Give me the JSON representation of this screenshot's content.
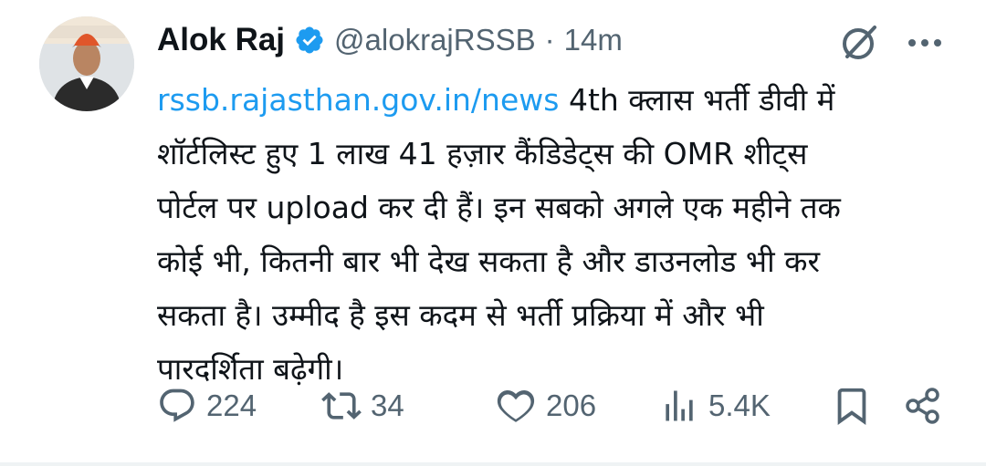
{
  "tweet": {
    "author_name": "Alok Raj",
    "handle": "@alokrajRSSB",
    "separator": "·",
    "time": "14m",
    "link_text": "rssb.rajasthan.gov.in/news",
    "text_line1": "4th क्लास भर्ती डीवी में",
    "text_line2": "शॉर्टलिस्ट हुए 1 लाख 41 हज़ार कैंडिडेट्स की OMR शीट्स",
    "text_line3": "पोर्टल पर upload कर दी हैं। इन सबको अगले एक महीने तक",
    "text_line4": "कोई भी, कितनी बार भी देख सकता है और डाउनलोड भी कर",
    "text_line5": "सकता है। उम्मीद है इस कदम से भर्ती प्रक्रिया में और भी",
    "text_line6": "पारदर्शिता बढ़ेगी।"
  },
  "stats": {
    "replies": "224",
    "reposts": "34",
    "likes": "206",
    "views": "5.4K"
  },
  "colors": {
    "link": "#1d9bf0",
    "verified_badge": "#1d9bf0",
    "secondary_text": "#536471",
    "primary_text": "#0f1419"
  },
  "icons": {
    "verified": "verified-badge-icon",
    "grok": "grok-icon",
    "more": "more-options-icon",
    "reply": "reply-icon",
    "repost": "repost-icon",
    "like": "heart-icon",
    "views": "views-chart-icon",
    "bookmark": "bookmark-icon",
    "share": "share-icon"
  }
}
